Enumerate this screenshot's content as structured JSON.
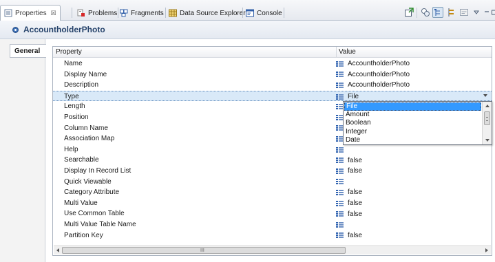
{
  "tabs": [
    {
      "label": "Properties",
      "close": "☒",
      "icon": "properties-icon"
    },
    {
      "label": "Problems",
      "icon": "problems-icon"
    },
    {
      "label": "Fragments",
      "icon": "fragments-icon"
    },
    {
      "label": "Data Source Explorer",
      "icon": "data-source-explorer-icon"
    },
    {
      "label": "Console",
      "icon": "console-icon"
    }
  ],
  "toolbar": {
    "buttons": [
      "pin-icon",
      "show-categories-icon",
      "show-tree-icon",
      "show-advanced-icon",
      "restore-defaults-icon",
      "view-menu-icon",
      "minimize-icon"
    ]
  },
  "title": "AccountholderPhoto",
  "sections": [
    "General"
  ],
  "grid": {
    "headers": {
      "property": "Property",
      "value": "Value"
    },
    "rows": [
      {
        "name": "Name",
        "value": "AccountholderPhoto"
      },
      {
        "name": "Display Name",
        "value": "AccountholderPhoto"
      },
      {
        "name": "Description",
        "value": "AccountholderPhoto"
      },
      {
        "name": "Type",
        "value": "File"
      },
      {
        "name": "Length",
        "value": ""
      },
      {
        "name": "Position",
        "value": ""
      },
      {
        "name": "Column Name",
        "value": ""
      },
      {
        "name": "Association Map",
        "value": ""
      },
      {
        "name": "Help",
        "value": ""
      },
      {
        "name": "Searchable",
        "value": "false"
      },
      {
        "name": "Display In Record List",
        "value": "false"
      },
      {
        "name": "Quick Viewable",
        "value": ""
      },
      {
        "name": "Category Attribute",
        "value": "false"
      },
      {
        "name": "Multi Value",
        "value": "false"
      },
      {
        "name": "Use Common Table",
        "value": "false"
      },
      {
        "name": "Multi Value Table Name",
        "value": ""
      },
      {
        "name": "Partition Key",
        "value": "false"
      }
    ],
    "selected_row": "Type"
  },
  "type_dropdown": {
    "selected": "File",
    "options": [
      "File",
      "Amount",
      "Boolean",
      "Integer",
      "Date"
    ]
  },
  "hscroll": {
    "grip": "III"
  },
  "colors": {
    "title": "#26436b",
    "selection": "#3399ff",
    "row_highlight": "#d9e9f8"
  }
}
